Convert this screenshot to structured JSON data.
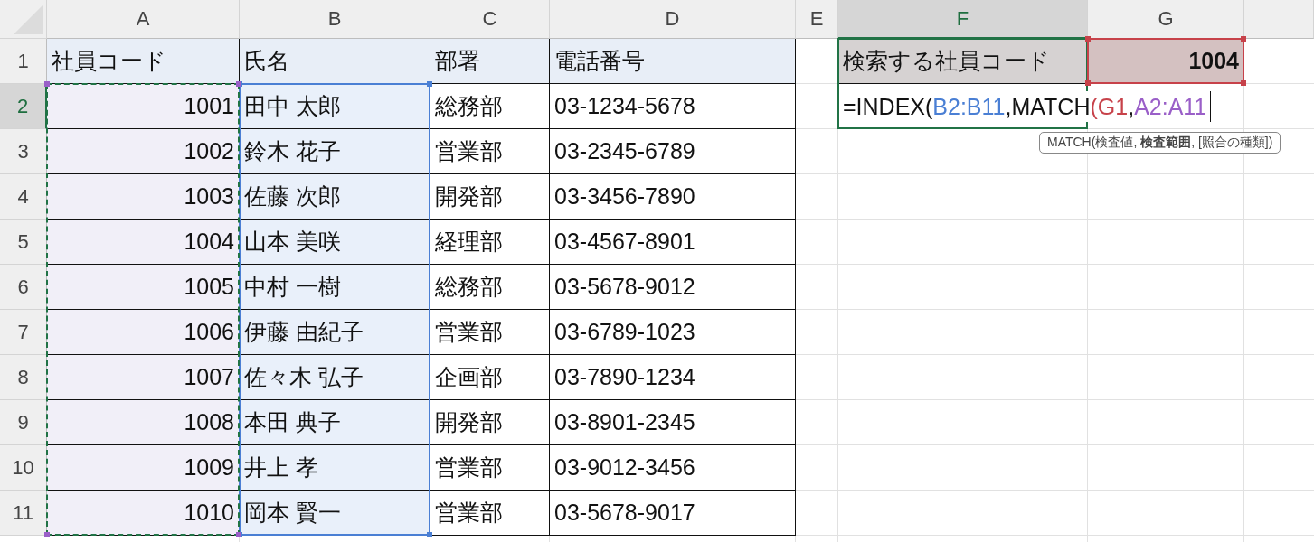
{
  "columns": [
    {
      "label": "A",
      "selected": false
    },
    {
      "label": "B",
      "selected": false
    },
    {
      "label": "C",
      "selected": false
    },
    {
      "label": "D",
      "selected": false
    },
    {
      "label": "E",
      "selected": false
    },
    {
      "label": "F",
      "selected": true
    },
    {
      "label": "G",
      "selected": false
    }
  ],
  "rows": [
    {
      "label": "1",
      "selected": false,
      "cells": [
        "社員コード",
        "氏名",
        "部署",
        "電話番号"
      ]
    },
    {
      "label": "2",
      "selected": true,
      "cells": [
        "1001",
        "田中 太郎",
        "総務部",
        "03-1234-5678"
      ]
    },
    {
      "label": "3",
      "selected": false,
      "cells": [
        "1002",
        "鈴木 花子",
        "営業部",
        "03-2345-6789"
      ]
    },
    {
      "label": "4",
      "selected": false,
      "cells": [
        "1003",
        "佐藤 次郎",
        "開発部",
        "03-3456-7890"
      ]
    },
    {
      "label": "5",
      "selected": false,
      "cells": [
        "1004",
        "山本 美咲",
        "経理部",
        "03-4567-8901"
      ]
    },
    {
      "label": "6",
      "selected": false,
      "cells": [
        "1005",
        "中村 一樹",
        "総務部",
        "03-5678-9012"
      ]
    },
    {
      "label": "7",
      "selected": false,
      "cells": [
        "1006",
        "伊藤 由紀子",
        "営業部",
        "03-6789-1023"
      ]
    },
    {
      "label": "8",
      "selected": false,
      "cells": [
        "1007",
        "佐々木 弘子",
        "企画部",
        "03-7890-1234"
      ]
    },
    {
      "label": "9",
      "selected": false,
      "cells": [
        "1008",
        "本田 典子",
        "開発部",
        "03-8901-2345"
      ]
    },
    {
      "label": "10",
      "selected": false,
      "cells": [
        "1009",
        "井上 孝",
        "営業部",
        "03-9012-3456"
      ]
    },
    {
      "label": "11",
      "selected": false,
      "cells": [
        "1010",
        "岡本 賢一",
        "営業部",
        "03-5678-9017"
      ]
    }
  ],
  "lookup": {
    "label": "検索する社員コード",
    "value": "1004"
  },
  "editing": {
    "segments": [
      {
        "kind": "text",
        "text": "=INDEX("
      },
      {
        "kind": "reference",
        "text": "B2:B11",
        "color": "#4a7fd4",
        "marquee": false
      },
      {
        "kind": "text",
        "text": ",MATCH"
      },
      {
        "kind": "reference",
        "text": "(G1",
        "color": "#c7424a",
        "marquee": false
      },
      {
        "kind": "text",
        "text": ","
      },
      {
        "kind": "reference",
        "text": "A2:A11",
        "color": "#9a5fc8",
        "marquee": true
      }
    ]
  },
  "tooltip": "MATCH(検査値, **検査範囲**, [照合の種類])"
}
